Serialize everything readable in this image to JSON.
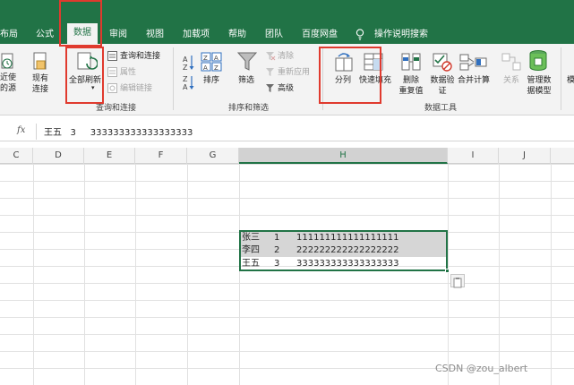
{
  "tabs": [
    {
      "label": "布局"
    },
    {
      "label": "公式"
    },
    {
      "label": "数据",
      "active": true
    },
    {
      "label": "审阅"
    },
    {
      "label": "视图"
    },
    {
      "label": "加载项"
    },
    {
      "label": "帮助"
    },
    {
      "label": "团队"
    },
    {
      "label": "百度网盘"
    },
    {
      "label": "操作说明搜索"
    }
  ],
  "ribbon": {
    "get_data": {
      "recent_sources": [
        "近使",
        "的源"
      ],
      "existing_connections": [
        "现有",
        "连接"
      ],
      "refresh_all": "全部刷新",
      "queries_connections": "查询和连接",
      "properties": "属性",
      "edit_links": "编辑链接",
      "group_label": "查询和连接"
    },
    "sort_filter": {
      "sort": "排序",
      "filter": "筛选",
      "clear": "清除",
      "reapply": "重新应用",
      "advanced": "高级",
      "group_label": "排序和筛选"
    },
    "data_tools": {
      "text_to_columns": "分列",
      "flash_fill": "快速填充",
      "remove_duplicates": [
        "删除",
        "重复值"
      ],
      "data_validation": [
        "数据验",
        "证"
      ],
      "consolidate": "合并计算",
      "relationships": "关系",
      "data_model": [
        "管理数",
        "据模型"
      ],
      "group_label": "数据工具"
    },
    "extra": "模"
  },
  "formula_bar": {
    "fx": "fx",
    "content": "王五   3     333333333333333333"
  },
  "columns": [
    {
      "label": "C",
      "selected": false
    },
    {
      "label": "D",
      "selected": false
    },
    {
      "label": "E",
      "selected": false
    },
    {
      "label": "F",
      "selected": false
    },
    {
      "label": "G",
      "selected": false
    },
    {
      "label": "H",
      "selected": true
    },
    {
      "label": "I",
      "selected": false
    },
    {
      "label": "J",
      "selected": false
    }
  ],
  "cells": [
    {
      "name": "张三",
      "num": "1",
      "value": "111111111111111111"
    },
    {
      "name": "李四",
      "num": "2",
      "value": "222222222222222222"
    },
    {
      "name": "王五",
      "num": "3",
      "value": "333333333333333333"
    }
  ],
  "watermark": "CSDN @zou_albert",
  "colors": {
    "accent": "#217346",
    "highlight": "#e03a2e",
    "ribbon_bg": "#f3f3f3"
  }
}
